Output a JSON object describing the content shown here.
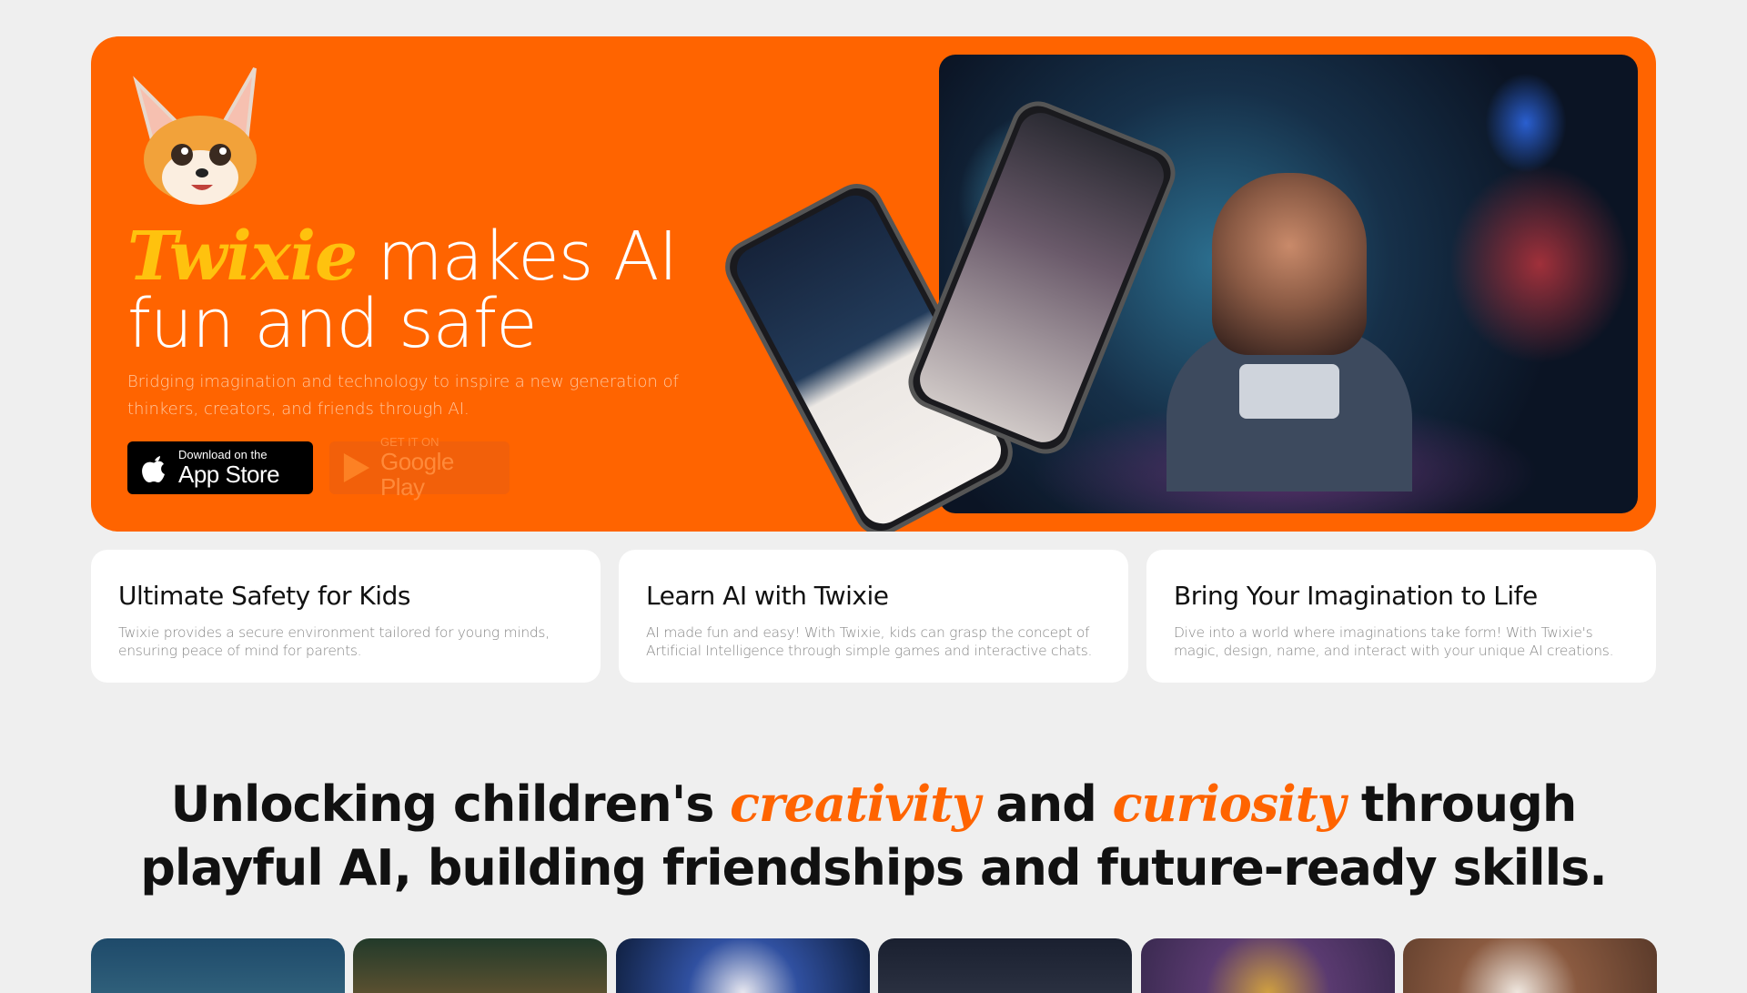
{
  "hero": {
    "brand": "Twixie",
    "title_rest_line1": " makes AI",
    "title_line2": "fun and safe",
    "subtitle": "Bridging imagination and technology to inspire a new generation of thinkers, creators, and friends through AI.",
    "appstore": {
      "small": "Download on the",
      "big": "App Store",
      "icon": "apple-icon"
    },
    "googleplay": {
      "small": "GET IT ON",
      "big": "Google Play",
      "icon": "play-icon"
    },
    "colors": {
      "background": "#ff6400",
      "brand": "#ffc20e"
    }
  },
  "features": [
    {
      "title": "Ultimate Safety for Kids",
      "description": "Twixie provides a secure environment tailored for young minds, ensuring peace of mind for parents."
    },
    {
      "title": "Learn AI with Twixie",
      "description": "AI made fun and easy! With Twixie, kids can grasp the concept of Artificial Intelligence through simple games and interactive chats."
    },
    {
      "title": "Bring Your Imagination to Life",
      "description": "Dive into a world where imaginations take form! With Twixie's magic, design, name, and interact with your unique AI creations."
    }
  ],
  "headline": {
    "part1": "Unlocking children's ",
    "highlight1": "creativity",
    "part2": " and ",
    "highlight2": "curiosity",
    "part3": " through playful AI, building friendships and future-ready skills."
  }
}
